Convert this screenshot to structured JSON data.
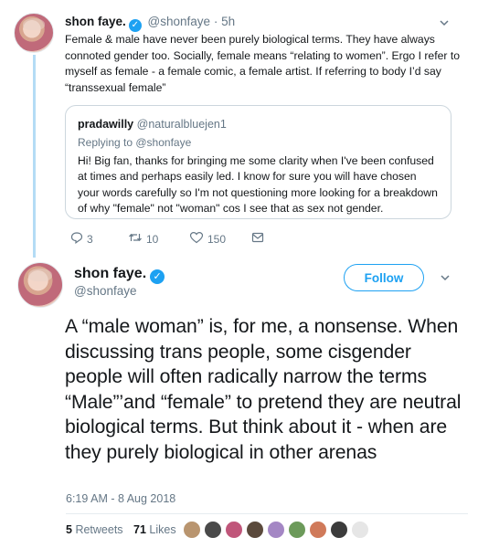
{
  "tweet1": {
    "name": "shon faye.",
    "handle": "@shonfaye",
    "dot": "·",
    "time": "5h",
    "text": "Female & male have never been purely biological terms. They have always connoted gender too. Socially, female means “relating to women”. Ergo I refer to myself as female - a female comic, a female artist. If referring to body I’d say “transsexual female”",
    "quote": {
      "name": "pradawilly",
      "handle": "@naturalbluejen1",
      "replying": "Replying to @shonfaye",
      "text": "Hi! Big fan, thanks for bringing me some clarity when I've been confused at times and perhaps easily led. I know for sure you will have chosen your words carefully so I'm not questioning more looking for a breakdown of why \"female\" not \"woman\" cos I see that as sex not gender."
    },
    "actions": {
      "replies": "3",
      "retweets": "10",
      "likes": "150"
    }
  },
  "tweet2": {
    "name": "shon faye.",
    "handle": "@shonfaye",
    "follow_label": "Follow",
    "text": "A “male woman” is, for me, a nonsense. When discussing trans people, some cisgender people will often radically narrow the terms “Male”’and “female” to pretend they are neutral biological terms. But think about it - when are they purely biological in other arenas",
    "timestamp": "6:19 AM - 8 Aug 2018",
    "retweet_count": "5",
    "retweet_label": "Retweets",
    "like_count": "71",
    "like_label": "Likes"
  },
  "icons": {
    "reply": "reply-icon",
    "retweet": "retweet-icon",
    "like": "heart-icon",
    "dm": "envelope-icon",
    "verified": "verified-badge-icon",
    "chevron": "chevron-down-icon"
  },
  "colors": {
    "accent": "#1da1f2",
    "muted": "#657786",
    "text": "#14171a",
    "thread": "#b4dcf5"
  }
}
